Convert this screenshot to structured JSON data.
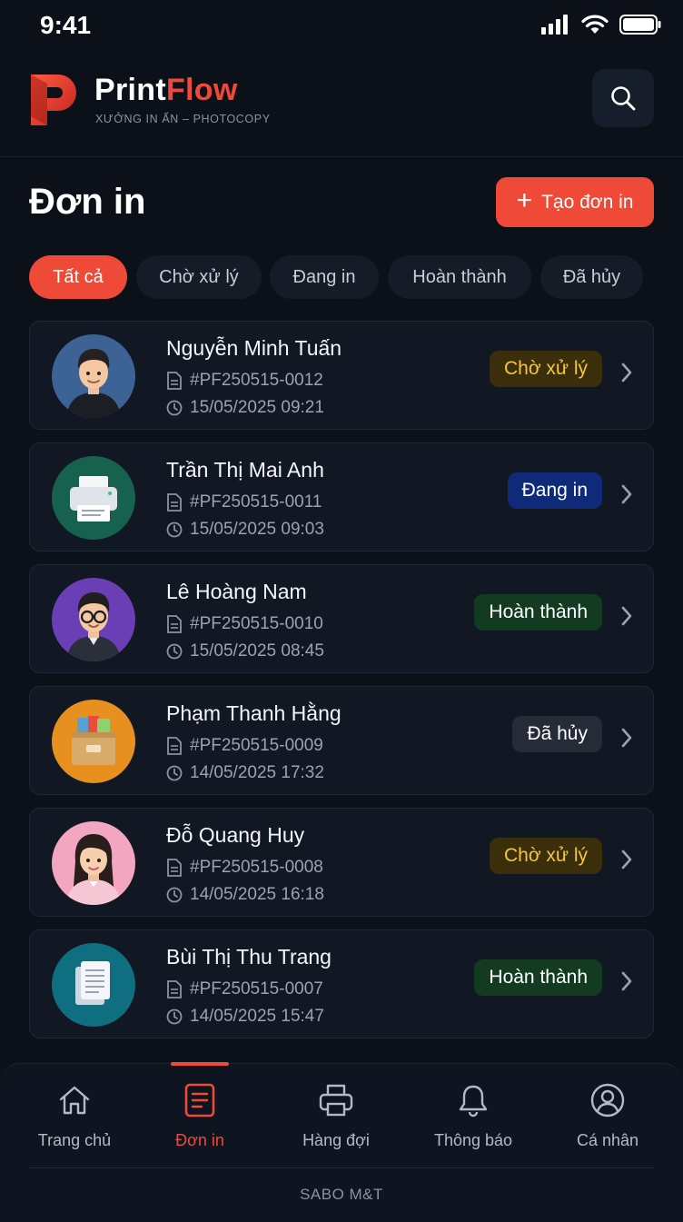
{
  "status_bar": {
    "time": "9:41"
  },
  "header": {
    "brand_part1": "Print",
    "brand_part2": "Flow",
    "tagline": "XƯỞNG IN ẤN – PHOTOCOPY",
    "search_icon": "search-icon"
  },
  "page": {
    "title": "Đơn in",
    "create_button": "Tạo đơn in"
  },
  "filters": [
    {
      "label": "Tất cả",
      "active": true
    },
    {
      "label": "Chờ xử lý",
      "active": false
    },
    {
      "label": "Đang in",
      "active": false
    },
    {
      "label": "Hoàn thành",
      "active": false
    },
    {
      "label": "Đã hủy",
      "active": false
    }
  ],
  "orders": [
    {
      "name": "Nguyễn Minh Tuấn",
      "code": "#PF250515-0012",
      "datetime": "15/05/2025 09:21",
      "status": "Chờ xử lý",
      "status_kind": "pending",
      "avatar": "man-avatar"
    },
    {
      "name": "Trần Thị Mai Anh",
      "code": "#PF250515-0011",
      "datetime": "15/05/2025 09:03",
      "status": "Đang in",
      "status_kind": "printing",
      "avatar": "printer-avatar"
    },
    {
      "name": "Lê Hoàng Nam",
      "code": "#PF250515-0010",
      "datetime": "15/05/2025 08:45",
      "status": "Hoàn thành",
      "status_kind": "done",
      "avatar": "man-glasses-avatar"
    },
    {
      "name": "Phạm Thanh Hằng",
      "code": "#PF250515-0009",
      "datetime": "14/05/2025 17:32",
      "status": "Đã hủy",
      "status_kind": "cancel",
      "avatar": "file-box-avatar"
    },
    {
      "name": "Đỗ Quang Huy",
      "code": "#PF250515-0008",
      "datetime": "14/05/2025 16:18",
      "status": "Chờ xử lý",
      "status_kind": "pending",
      "avatar": "woman-avatar"
    },
    {
      "name": "Bùi Thị Thu Trang",
      "code": "#PF250515-0007",
      "datetime": "14/05/2025 15:47",
      "status": "Hoàn thành",
      "status_kind": "done",
      "avatar": "documents-avatar"
    }
  ],
  "bottom_nav": {
    "items": [
      {
        "label": "Trang chủ",
        "icon": "home-icon",
        "active": false
      },
      {
        "label": "Đơn in",
        "icon": "document-icon",
        "active": true
      },
      {
        "label": "Hàng đợi",
        "icon": "printer-icon",
        "active": false
      },
      {
        "label": "Thông báo",
        "icon": "bell-icon",
        "active": false
      },
      {
        "label": "Cá nhân",
        "icon": "user-icon",
        "active": false
      }
    ],
    "footer": "SABO M&T"
  },
  "colors": {
    "accent": "#ef4a38",
    "background": "#0c1119",
    "pending": "#f5c53b",
    "printing_bg": "#0e2a78",
    "done_bg": "#123b22"
  }
}
